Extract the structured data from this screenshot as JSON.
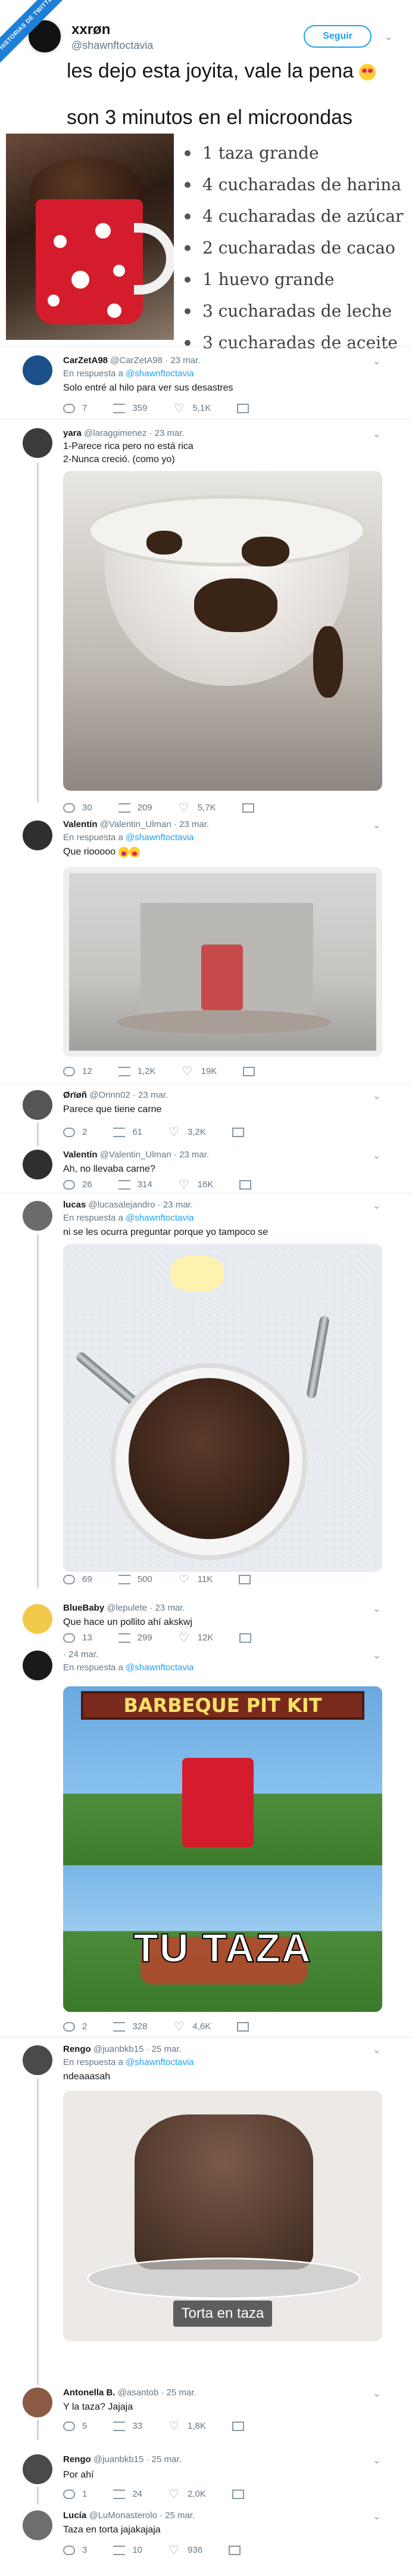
{
  "ribbon": "HISTORIAS DE TWITTER",
  "main": {
    "author_name": "xxrøn",
    "author_handle": "@shawnftoctavia",
    "follow_label": "Seguir",
    "text_1": "les dejo esta joyita, vale la pena",
    "text_2": "son 3 minutos en el microondas",
    "ingredients": [
      "1 taza grande",
      "4 cucharadas de harina",
      "4 cucharadas de azúcar",
      "2 cucharadas de cacao",
      "1 huevo grande",
      "3 cucharadas de leche",
      "3 cucharadas de aceite"
    ]
  },
  "replies": [
    {
      "name": "CarZetA98",
      "handle": "@CarZetA98",
      "date": "23 mar.",
      "in_reply": "En respuesta a",
      "in_reply_to": "@shawnftoctavia",
      "text": "Solo entré al hilo para ver sus desastres",
      "replies": "7",
      "retweets": "359",
      "likes": "5,1K"
    },
    {
      "name": "yara",
      "handle": "@laraggimenez",
      "date": "23 mar.",
      "text": "1-Parece rica pero no está rica\n2-Nunca creció. (como yo)",
      "replies": "30",
      "retweets": "209",
      "likes": "5,7K"
    },
    {
      "name": "Valentín",
      "handle": "@Valentin_Ulman",
      "date": "23 mar.",
      "in_reply": "En respuesta a",
      "in_reply_to": "@shawnftoctavia",
      "text": "Que riooooo",
      "replies": "12",
      "retweets": "1,2K",
      "likes": "19K"
    },
    {
      "name": "Ørïøñ",
      "handle": "@Orinn02",
      "date": "23 mar.",
      "text": "Parece que tiene carne",
      "replies": "2",
      "retweets": "61",
      "likes": "3,2K"
    },
    {
      "name": "Valentín",
      "handle": "@Valentin_Ulman",
      "date": "23 mar.",
      "text": "Ah, no llevaba carne?",
      "replies": "26",
      "retweets": "314",
      "likes": "16K"
    },
    {
      "name": "lucas",
      "handle": "@lucasalejandro",
      "date": "23 mar.",
      "in_reply": "En respuesta a",
      "in_reply_to": "@shawnftoctavia",
      "text": "ni se les ocurra preguntar porque yo tampoco se",
      "replies": "69",
      "retweets": "500",
      "likes": "11K"
    },
    {
      "name": "BlueBaby",
      "handle": "@lepulete",
      "date": "23 mar.",
      "text": "Que hace un pollito ahí akskwj",
      "replies": "13",
      "retweets": "299",
      "likes": "12K"
    },
    {
      "name": "",
      "handle": "",
      "date": "24 mar.",
      "in_reply": "En respuesta a",
      "in_reply_to": "@shawnftoctavia",
      "text": "",
      "meme_sign": "BARBEQUE PIT KIT",
      "meme_caption": "TU TAZA",
      "replies": "2",
      "retweets": "328",
      "likes": "4,6K"
    },
    {
      "name": "Rengo",
      "handle": "@juanbkb15",
      "date": "25 mar.",
      "in_reply": "En respuesta a",
      "in_reply_to": "@shawnftoctavia",
      "text": "ndeaaasah",
      "photo_caption": "Torta en taza",
      "replies": "",
      "retweets": "",
      "likes": ""
    },
    {
      "name": "Antonella B.",
      "handle": "@asantob",
      "date": "25 mar.",
      "text": "Y la taza? Jajaja",
      "replies": "5",
      "retweets": "33",
      "likes": "1,8K"
    },
    {
      "name": "Rengo",
      "handle": "@juanbkb15",
      "date": "25 mar.",
      "text": "Por ahí",
      "replies": "1",
      "retweets": "24",
      "likes": "2,0K"
    },
    {
      "name": "Lucía",
      "handle": "@LuMonasterolo",
      "date": "25 mar.",
      "text": "Taza en torta jajakajaja",
      "replies": "3",
      "retweets": "10",
      "likes": "936"
    }
  ]
}
